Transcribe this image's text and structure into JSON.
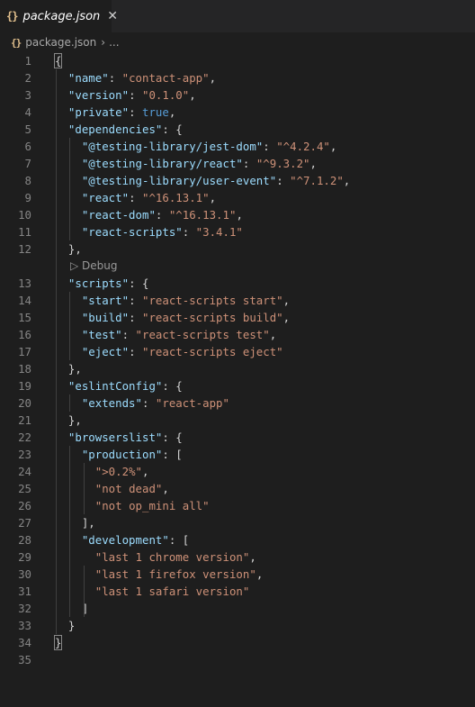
{
  "tab": {
    "icon": "json-braces-icon",
    "filename": "package.json",
    "close_glyph": "✕"
  },
  "breadcrumb": {
    "icon": "json-braces-icon",
    "file": "package.json",
    "separator": "›",
    "ellipsis": "..."
  },
  "codelens": {
    "glyph": "▷",
    "label": "Debug"
  },
  "lines": [
    {
      "n": "1",
      "indent": 0,
      "tokens": [
        [
          "p",
          "{"
        ]
      ]
    },
    {
      "n": "2",
      "indent": 1,
      "tokens": [
        [
          "k",
          "\"name\""
        ],
        [
          "p",
          ": "
        ],
        [
          "s",
          "\"contact-app\""
        ],
        [
          "p",
          ","
        ]
      ]
    },
    {
      "n": "3",
      "indent": 1,
      "tokens": [
        [
          "k",
          "\"version\""
        ],
        [
          "p",
          ": "
        ],
        [
          "s",
          "\"0.1.0\""
        ],
        [
          "p",
          ","
        ]
      ]
    },
    {
      "n": "4",
      "indent": 1,
      "tokens": [
        [
          "k",
          "\"private\""
        ],
        [
          "p",
          ": "
        ],
        [
          "b",
          "true"
        ],
        [
          "p",
          ","
        ]
      ]
    },
    {
      "n": "5",
      "indent": 1,
      "tokens": [
        [
          "k",
          "\"dependencies\""
        ],
        [
          "p",
          ": {"
        ]
      ]
    },
    {
      "n": "6",
      "indent": 2,
      "tokens": [
        [
          "k",
          "\"@testing-library/jest-dom\""
        ],
        [
          "p",
          ": "
        ],
        [
          "s",
          "\"^4.2.4\""
        ],
        [
          "p",
          ","
        ]
      ]
    },
    {
      "n": "7",
      "indent": 2,
      "tokens": [
        [
          "k",
          "\"@testing-library/react\""
        ],
        [
          "p",
          ": "
        ],
        [
          "s",
          "\"^9.3.2\""
        ],
        [
          "p",
          ","
        ]
      ]
    },
    {
      "n": "8",
      "indent": 2,
      "tokens": [
        [
          "k",
          "\"@testing-library/user-event\""
        ],
        [
          "p",
          ": "
        ],
        [
          "s",
          "\"^7.1.2\""
        ],
        [
          "p",
          ","
        ]
      ]
    },
    {
      "n": "9",
      "indent": 2,
      "tokens": [
        [
          "k",
          "\"react\""
        ],
        [
          "p",
          ": "
        ],
        [
          "s",
          "\"^16.13.1\""
        ],
        [
          "p",
          ","
        ]
      ]
    },
    {
      "n": "10",
      "indent": 2,
      "tokens": [
        [
          "k",
          "\"react-dom\""
        ],
        [
          "p",
          ": "
        ],
        [
          "s",
          "\"^16.13.1\""
        ],
        [
          "p",
          ","
        ]
      ]
    },
    {
      "n": "11",
      "indent": 2,
      "tokens": [
        [
          "k",
          "\"react-scripts\""
        ],
        [
          "p",
          ": "
        ],
        [
          "s",
          "\"3.4.1\""
        ]
      ]
    },
    {
      "n": "12",
      "indent": 1,
      "tokens": [
        [
          "p",
          "},"
        ]
      ]
    },
    {
      "n": "",
      "codelens": true
    },
    {
      "n": "13",
      "indent": 1,
      "tokens": [
        [
          "k",
          "\"scripts\""
        ],
        [
          "p",
          ": {"
        ]
      ]
    },
    {
      "n": "14",
      "indent": 2,
      "tokens": [
        [
          "k",
          "\"start\""
        ],
        [
          "p",
          ": "
        ],
        [
          "s",
          "\"react-scripts start\""
        ],
        [
          "p",
          ","
        ]
      ]
    },
    {
      "n": "15",
      "indent": 2,
      "tokens": [
        [
          "k",
          "\"build\""
        ],
        [
          "p",
          ": "
        ],
        [
          "s",
          "\"react-scripts build\""
        ],
        [
          "p",
          ","
        ]
      ]
    },
    {
      "n": "16",
      "indent": 2,
      "tokens": [
        [
          "k",
          "\"test\""
        ],
        [
          "p",
          ": "
        ],
        [
          "s",
          "\"react-scripts test\""
        ],
        [
          "p",
          ","
        ]
      ]
    },
    {
      "n": "17",
      "indent": 2,
      "tokens": [
        [
          "k",
          "\"eject\""
        ],
        [
          "p",
          ": "
        ],
        [
          "s",
          "\"react-scripts eject\""
        ]
      ]
    },
    {
      "n": "18",
      "indent": 1,
      "tokens": [
        [
          "p",
          "},"
        ]
      ]
    },
    {
      "n": "19",
      "indent": 1,
      "tokens": [
        [
          "k",
          "\"eslintConfig\""
        ],
        [
          "p",
          ": {"
        ]
      ]
    },
    {
      "n": "20",
      "indent": 2,
      "tokens": [
        [
          "k",
          "\"extends\""
        ],
        [
          "p",
          ": "
        ],
        [
          "s",
          "\"react-app\""
        ]
      ]
    },
    {
      "n": "21",
      "indent": 1,
      "tokens": [
        [
          "p",
          "},"
        ]
      ]
    },
    {
      "n": "22",
      "indent": 1,
      "tokens": [
        [
          "k",
          "\"browserslist\""
        ],
        [
          "p",
          ": {"
        ]
      ]
    },
    {
      "n": "23",
      "indent": 2,
      "tokens": [
        [
          "k",
          "\"production\""
        ],
        [
          "p",
          ": ["
        ]
      ]
    },
    {
      "n": "24",
      "indent": 3,
      "tokens": [
        [
          "s",
          "\">0.2%\""
        ],
        [
          "p",
          ","
        ]
      ]
    },
    {
      "n": "25",
      "indent": 3,
      "tokens": [
        [
          "s",
          "\"not dead\""
        ],
        [
          "p",
          ","
        ]
      ]
    },
    {
      "n": "26",
      "indent": 3,
      "tokens": [
        [
          "s",
          "\"not op_mini all\""
        ]
      ]
    },
    {
      "n": "27",
      "indent": 2,
      "tokens": [
        [
          "p",
          "],"
        ]
      ]
    },
    {
      "n": "28",
      "indent": 2,
      "tokens": [
        [
          "k",
          "\"development\""
        ],
        [
          "p",
          ": ["
        ]
      ]
    },
    {
      "n": "29",
      "indent": 3,
      "tokens": [
        [
          "s",
          "\"last 1 chrome version\""
        ],
        [
          "p",
          ","
        ]
      ]
    },
    {
      "n": "30",
      "indent": 3,
      "tokens": [
        [
          "s",
          "\"last 1 firefox version\""
        ],
        [
          "p",
          ","
        ]
      ]
    },
    {
      "n": "31",
      "indent": 3,
      "tokens": [
        [
          "s",
          "\"last 1 safari version\""
        ]
      ]
    },
    {
      "n": "32",
      "indent": 2,
      "tokens": [
        [
          "p",
          "]"
        ]
      ]
    },
    {
      "n": "33",
      "indent": 1,
      "tokens": [
        [
          "p",
          "}"
        ]
      ]
    },
    {
      "n": "34",
      "indent": 0,
      "tokens": [
        [
          "p",
          "}"
        ]
      ]
    },
    {
      "n": "35",
      "indent": 0,
      "tokens": []
    }
  ],
  "colors": {
    "background": "#1e1e1e",
    "property_key": "#9cdcfe",
    "string_value": "#ce9178",
    "keyword": "#569cd6",
    "punctuation": "#d4d4d4",
    "line_number": "#858585",
    "file_icon": "#e2c08d"
  }
}
